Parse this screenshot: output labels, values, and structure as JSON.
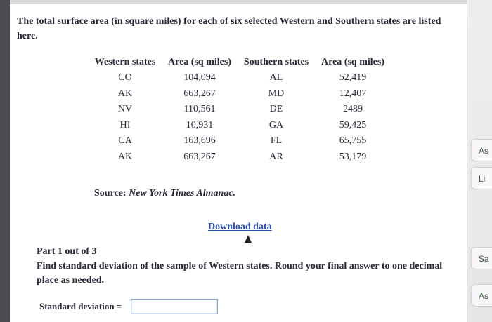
{
  "intro": "The total surface area (in square miles) for each of six selected Western and Southern states are listed here.",
  "table": {
    "headers": [
      "Western states",
      "Area (sq miles)",
      "Southern states",
      "Area (sq miles)"
    ],
    "rows": [
      [
        "CO",
        "104,094",
        "AL",
        "52,419"
      ],
      [
        "AK",
        "663,267",
        "MD",
        "12,407"
      ],
      [
        "NV",
        "110,561",
        "DE",
        "2489"
      ],
      [
        "HI",
        "10,931",
        "GA",
        "59,425"
      ],
      [
        "CA",
        "163,696",
        "FL",
        "65,755"
      ],
      [
        "AK",
        "663,267",
        "AR",
        "53,179"
      ]
    ]
  },
  "source": {
    "prefix": "Source: ",
    "title": "New York Times Almanac."
  },
  "download_label": "Download data",
  "part": "Part 1 out of 3",
  "question": "Find standard deviation of the sample of Western states. Round your final answer to one decimal place as needed.",
  "answer": {
    "label": "Standard deviation =",
    "value": ""
  },
  "side_buttons": [
    "As",
    "Li",
    "Sa",
    "As"
  ],
  "colors": {
    "link": "#2b4fb5",
    "input_border": "#8fa7c8",
    "left_border": "#4a4a50"
  }
}
